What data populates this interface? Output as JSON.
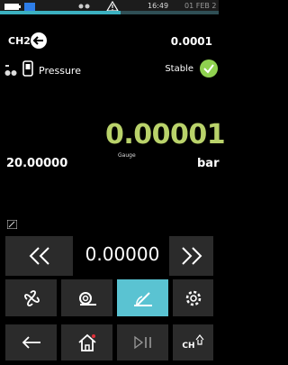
{
  "status": {
    "time": "16:49",
    "date": "01 FEB 2",
    "progress_pct": 55
  },
  "channel": {
    "label": "CH2",
    "value": "0.0001"
  },
  "sensor": {
    "title": "Pressure",
    "stable_label": "Stable"
  },
  "reading": {
    "main_value": "0.00001",
    "secondary_value": "20.00000",
    "mode_label": "Gauge",
    "unit": "bar"
  },
  "step_control": {
    "value": "0.00000",
    "decrease_icon": "double-chevron-left-icon",
    "increase_icon": "double-chevron-right-icon"
  },
  "tools": [
    {
      "icon": "fan-icon",
      "active": false
    },
    {
      "icon": "coil-icon",
      "active": false
    },
    {
      "icon": "gauge-needle-icon",
      "active": true
    },
    {
      "icon": "gear-icon",
      "active": false
    }
  ],
  "navbar": {
    "back_icon": "back-arrow-icon",
    "home_icon": "home-icon",
    "play_pause_icon": "play-pause-icon",
    "channel_icon": "channel-icon",
    "channel_label": "CH"
  },
  "colors": {
    "accent": "#5ac3d2",
    "value_green": "#b9d26a",
    "stable_green": "#8fd14f"
  }
}
